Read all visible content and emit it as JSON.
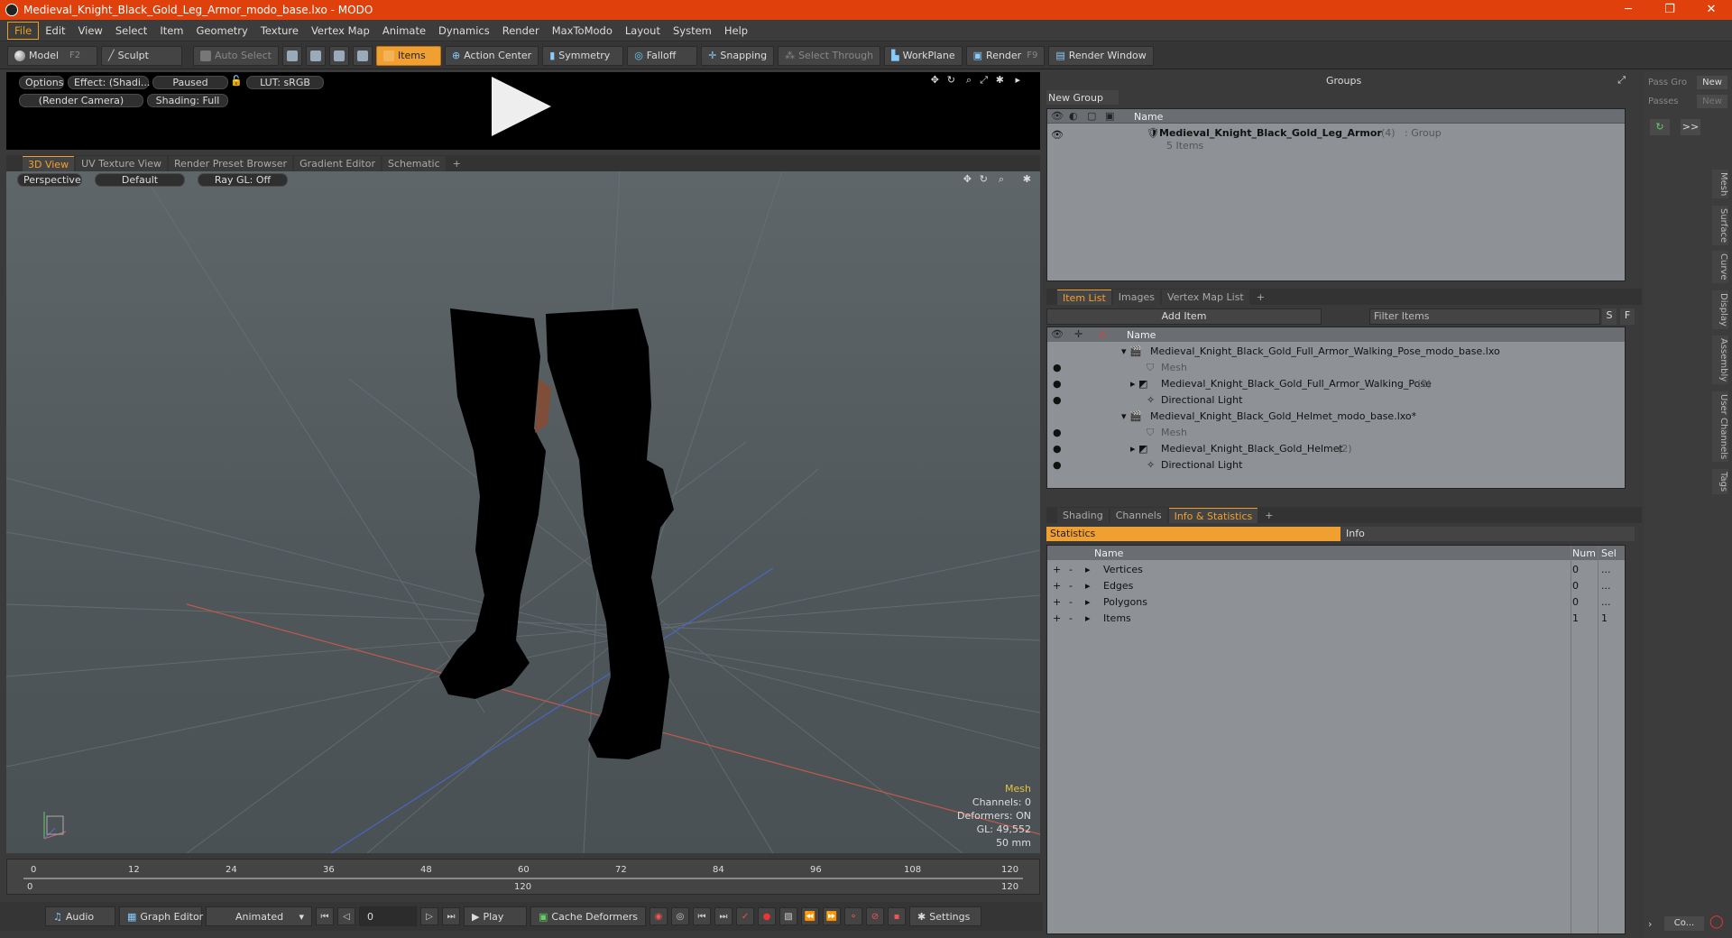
{
  "window": {
    "title": "Medieval_Knight_Black_Gold_Leg_Armor_modo_base.lxo - MODO",
    "min": "─",
    "max": "❐",
    "close": "✕"
  },
  "menu": [
    "File",
    "Edit",
    "View",
    "Select",
    "Item",
    "Geometry",
    "Texture",
    "Vertex Map",
    "Animate",
    "Dynamics",
    "Render",
    "MaxToModo",
    "Layout",
    "System",
    "Help"
  ],
  "toolbar": {
    "model": "Model",
    "model_key": "F2",
    "sculpt": "Sculpt",
    "auto_select": "Auto Select",
    "items": "Items",
    "action_center": "Action Center",
    "symmetry": "Symmetry",
    "falloff": "Falloff",
    "snapping": "Snapping",
    "select_through": "Select Through",
    "workplane": "WorkPlane",
    "render": "Render",
    "render_key": "F9",
    "render_window": "Render Window"
  },
  "preview": {
    "options": "Options",
    "effect": "Effect: (Shadi...",
    "paused": "Paused",
    "lut": "LUT: sRGB",
    "camera": "(Render Camera)",
    "shading": "Shading: Full"
  },
  "viewtabs": [
    "3D View",
    "UV Texture View",
    "Render Preset Browser",
    "Gradient Editor",
    "Schematic",
    "+"
  ],
  "viewport": {
    "projection": "Perspective",
    "style": "Default",
    "raygl": "Ray GL: Off",
    "hud": {
      "type": "Mesh",
      "channels": "Channels: 0",
      "deformers": "Deformers: ON",
      "gl": "GL: 49,552",
      "focal": "50 mm"
    }
  },
  "timeline": {
    "ticks": [
      "0",
      "12",
      "24",
      "36",
      "48",
      "60",
      "72",
      "84",
      "96",
      "108",
      "120"
    ],
    "start": "0",
    "mid": "120",
    "end": "120"
  },
  "transport": {
    "audio": "Audio",
    "graph_editor": "Graph Editor",
    "mode": "Animated",
    "frame": "0",
    "play": "Play",
    "cache": "Cache Deformers",
    "settings": "Settings"
  },
  "groups": {
    "title": "Groups",
    "new_group": "New Group",
    "col_name": "Name",
    "row_name": "Medieval_Knight_Black_Gold_Leg_Armor",
    "row_count": "(4)",
    "row_type": ": Group",
    "row_sub": "5 Items"
  },
  "passes": {
    "pass_groups": "Pass Gro",
    "passes": "Passes",
    "new": "New",
    "new2": "New"
  },
  "itemlist": {
    "tabs": [
      "Item List",
      "Images",
      "Vertex Map List",
      "+"
    ],
    "add_item": "Add Item",
    "filter": "Filter Items",
    "s": "S",
    "f": "F",
    "col_name": "Name",
    "rows": [
      {
        "label": "Medieval_Knight_Black_Gold_Full_Armor_Walking_Pose_modo_base.lxo",
        "extra": ""
      },
      {
        "label": "Mesh",
        "extra": ""
      },
      {
        "label": "Medieval_Knight_Black_Gold_Full_Armor_Walking_Pose",
        "extra": "(2)"
      },
      {
        "label": "Directional Light",
        "extra": ""
      },
      {
        "label": "Medieval_Knight_Black_Gold_Helmet_modo_base.lxo*",
        "extra": ""
      },
      {
        "label": "Mesh",
        "extra": ""
      },
      {
        "label": "Medieval_Knight_Black_Gold_Helmet",
        "extra": "(2)"
      },
      {
        "label": "Directional Light",
        "extra": ""
      }
    ]
  },
  "stats": {
    "tabs": [
      "Shading",
      "Channels",
      "Info & Statistics",
      "+"
    ],
    "statistics": "Statistics",
    "info": "Info",
    "col_name": "Name",
    "col_num": "Num",
    "col_sel": "Sel",
    "rows": [
      {
        "name": "Vertices",
        "num": "0",
        "sel": "..."
      },
      {
        "name": "Edges",
        "num": "0",
        "sel": "..."
      },
      {
        "name": "Polygons",
        "num": "0",
        "sel": "..."
      },
      {
        "name": "Items",
        "num": "1",
        "sel": "1"
      }
    ]
  },
  "sidetabs": [
    "Mesh",
    "Surface",
    "Curve",
    "Display",
    "Assembly",
    "User Channels",
    "Tags"
  ],
  "bottom_right": {
    "more": ">>",
    "co": "Co..."
  },
  "colors": {
    "accent": "#f0a030",
    "titlebar": "#e0400c",
    "panel": "#8e9296"
  }
}
